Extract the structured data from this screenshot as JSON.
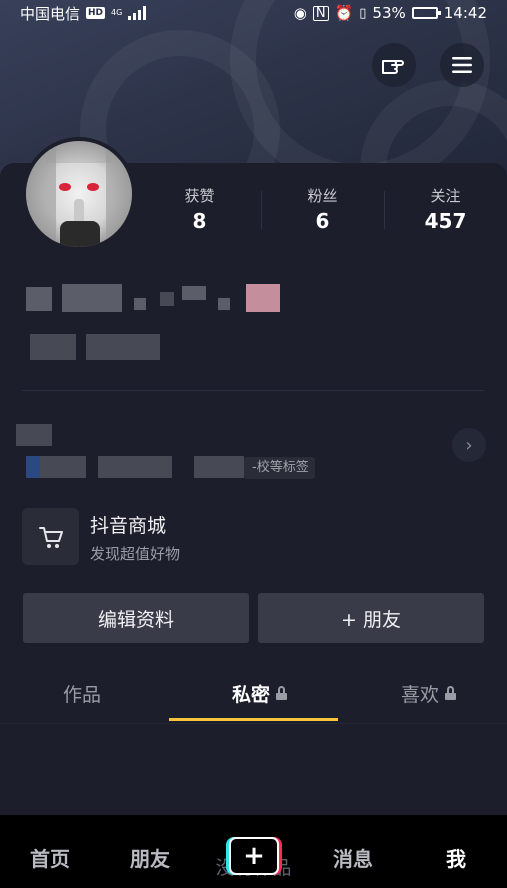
{
  "status_bar": {
    "carrier": "中国电信",
    "hd": "HD",
    "network": "4G",
    "battery": "53%",
    "battery_level": 0.53,
    "time": "14:42"
  },
  "header": {
    "share_icon": "pointing-hand-icon",
    "menu_icon": "hamburger-menu-icon"
  },
  "stats": [
    {
      "label": "获赞",
      "value": "8"
    },
    {
      "label": "粉丝",
      "value": "6"
    },
    {
      "label": "关注",
      "value": "457"
    }
  ],
  "tags": {
    "suffix": "-校等标签"
  },
  "mall": {
    "title": "抖音商城",
    "subtitle": "发现超值好物",
    "icon": "shopping-cart-icon"
  },
  "actions": {
    "edit": "编辑资料",
    "add_friend": "+ 朋友"
  },
  "tabs": [
    {
      "label": "作品"
    },
    {
      "label": "私密"
    },
    {
      "label": "喜欢"
    }
  ],
  "empty_state": "没有作品",
  "bottom_nav": {
    "home": "首页",
    "friends": "朋友",
    "create": "+",
    "messages": "消息",
    "me": "我"
  }
}
